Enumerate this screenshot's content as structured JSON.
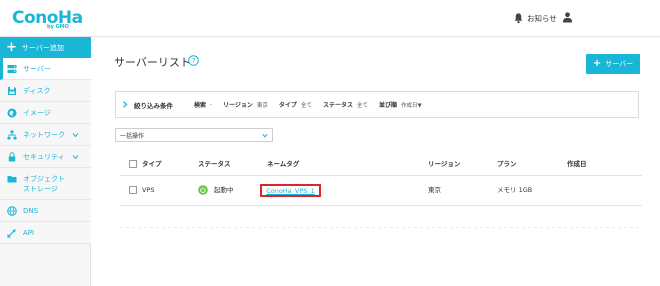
{
  "header": {
    "logo_text": "ConoHa",
    "logo_sub": "by GMO",
    "notifications_label": "お知らせ"
  },
  "sidebar": {
    "add_label": "サーバー追加",
    "items": [
      {
        "label": "サーバー",
        "icon": "server-icon"
      },
      {
        "label": "ディスク",
        "icon": "disk-icon"
      },
      {
        "label": "イメージ",
        "icon": "image-icon"
      },
      {
        "label": "ネットワーク",
        "icon": "network-icon"
      },
      {
        "label": "セキュリティ",
        "icon": "lock-icon"
      },
      {
        "label_line1": "オブジェクト",
        "label_line2": "ストレージ",
        "icon": "folder-icon"
      },
      {
        "label": "DNS",
        "icon": "dns-icon"
      },
      {
        "label": "API",
        "icon": "api-icon"
      }
    ]
  },
  "main": {
    "title": "サーバーリスト",
    "add_button": "サーバー",
    "filter": {
      "title": "絞り込み条件",
      "search_label": "検索",
      "search_value": "-",
      "region_label": "リージョン",
      "region_value": "東京",
      "type_label": "タイプ",
      "type_value": "全て",
      "status_label": "ステータス",
      "status_value": "全て",
      "sort_label": "並び順",
      "sort_value": "作成日▼"
    },
    "bulk_action": "一括操作",
    "table": {
      "headers": {
        "type": "タイプ",
        "status": "ステータス",
        "nametag": "ネームタグ",
        "region": "リージョン",
        "plan": "プラン",
        "created": "作成日"
      },
      "rows": [
        {
          "type": "VPS",
          "status": "起動中",
          "nametag": "ConoHa_VPS_1",
          "region": "東京",
          "plan": "メモリ 1GB",
          "created": ""
        }
      ]
    }
  },
  "colors": {
    "accent": "#19b6d8",
    "status_running": "#6cc04a",
    "highlight_border": "#d8282b"
  }
}
